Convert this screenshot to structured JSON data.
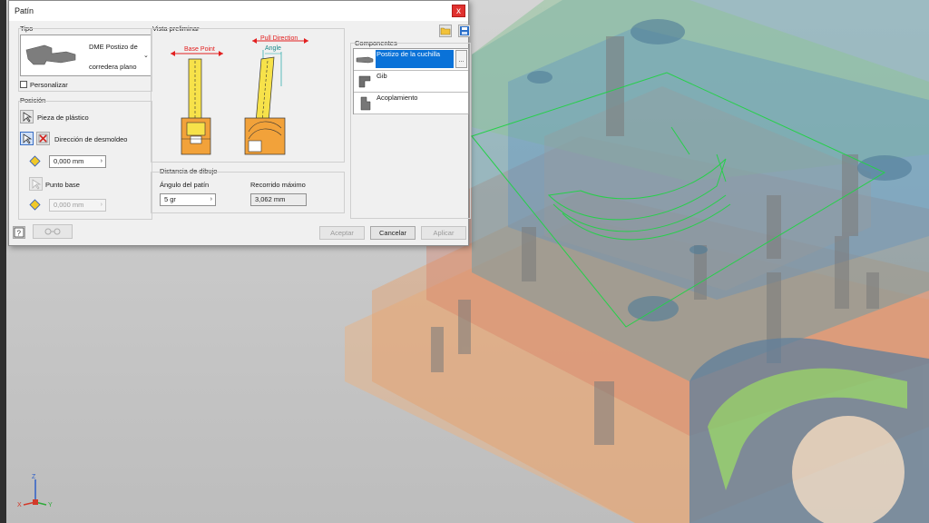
{
  "dialog": {
    "title": "Patín",
    "close_symbol": "x",
    "type_group": {
      "label": "Tipo",
      "selected_line1": "DME Postizo de",
      "selected_line2": "corredera plano",
      "customize_label": "Personalizar"
    },
    "position_group": {
      "label": "Posición",
      "plastic_part_label": "Pieza de plástico",
      "demold_direction_label": "Dirección de desmoldeo",
      "offset_value": "0,000 mm",
      "base_point_label": "Punto base",
      "base_offset_value": "0,000 mm"
    },
    "preview_group": {
      "label": "Vista preliminar",
      "base_point_annotation": "Base Point",
      "pull_direction_annotation": "Pull Direction",
      "angle_annotation": "Angle"
    },
    "drawing_distance_group": {
      "label": "Distancia de dibujo",
      "angle_label": "Ángulo del patín",
      "angle_value": "5 gr",
      "max_travel_label": "Recorrido máximo",
      "max_travel_value": "3,062 mm"
    },
    "components_group": {
      "label": "Componentes",
      "items": [
        {
          "label": "Postizo de la cuchilla",
          "selected": true,
          "more": "..."
        },
        {
          "label": "Gib",
          "selected": false
        },
        {
          "label": "Acoplamiento",
          "selected": false
        }
      ]
    },
    "footer": {
      "ok_label": "Aceptar",
      "cancel_label": "Cancelar",
      "apply_label": "Aplicar"
    }
  },
  "axes": {
    "x": "X",
    "y": "Y",
    "z": "Z"
  },
  "colors": {
    "accent": "#0a72d8",
    "close": "#e0312f",
    "outline": "#26d04a"
  }
}
